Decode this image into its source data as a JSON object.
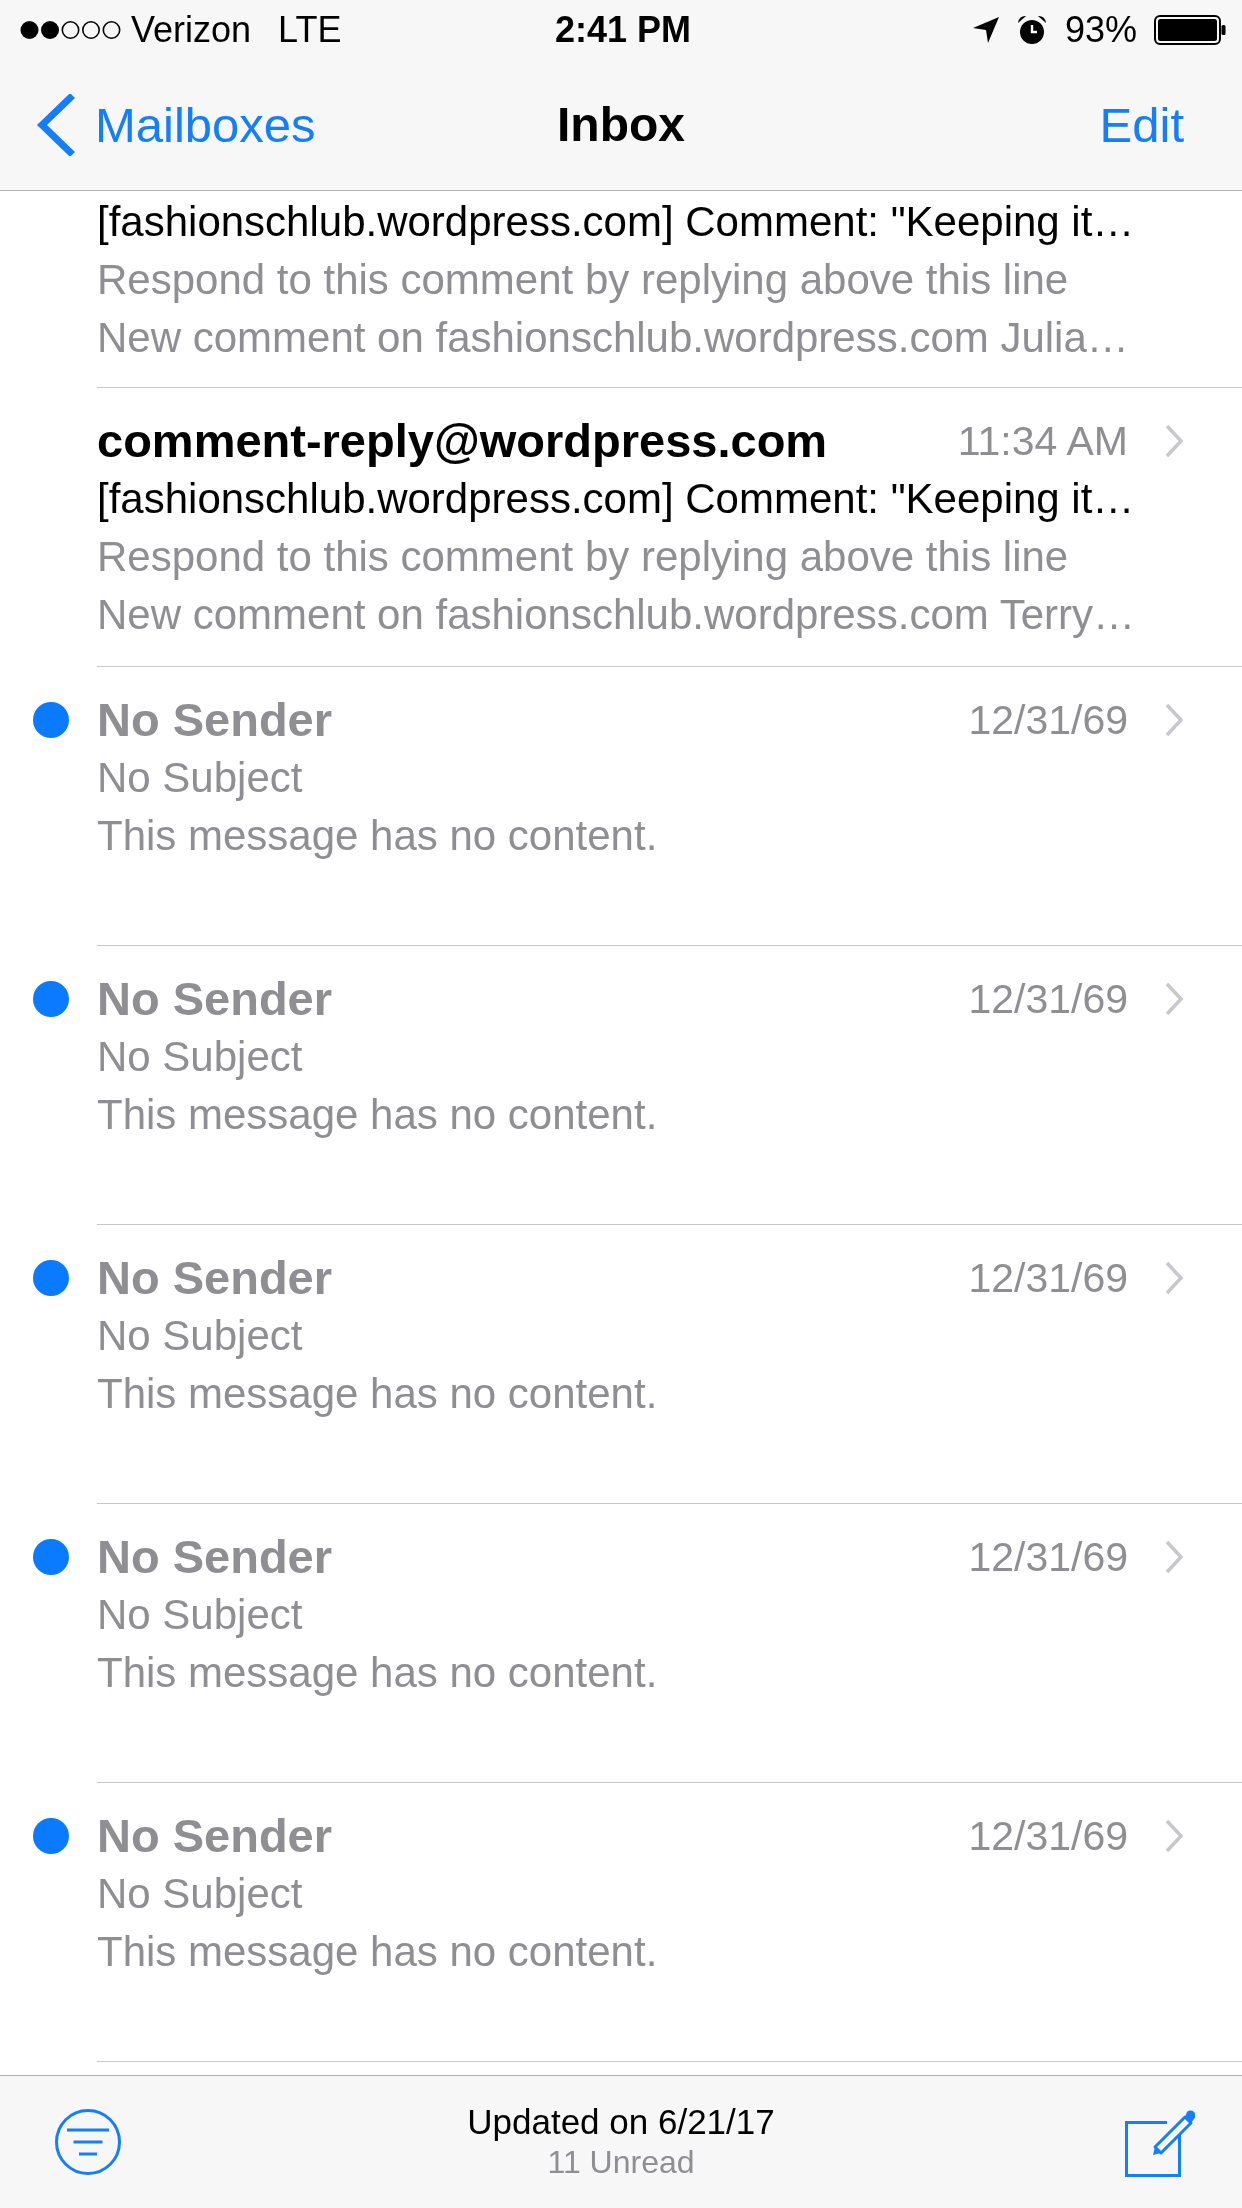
{
  "status_bar": {
    "carrier": "Verizon",
    "network": "LTE",
    "time": "2:41 PM",
    "battery": "93%"
  },
  "nav_bar": {
    "back": "Mailboxes",
    "title": "Inbox",
    "action": "Edit"
  },
  "messages": [
    {
      "kind": "mail",
      "unread": false,
      "subject": "[fashionschlub.wordpress.com] Comment: \"Keeping it…",
      "preview": [
        "Respond to this comment by replying above this line",
        "New comment on fashionschlub.wordpress.com Julia…"
      ]
    },
    {
      "kind": "mail",
      "unread": false,
      "sender": "comment-reply@wordpress.com",
      "time": "11:34 AM",
      "subject": "[fashionschlub.wordpress.com] Comment: \"Keeping it…",
      "preview": [
        "Respond to this comment by replying above this line",
        "New comment on fashionschlub.wordpress.com Terry…"
      ]
    },
    {
      "kind": "empty",
      "unread": true,
      "sender": "No Sender",
      "time": "12/31/69",
      "subject": "No Subject",
      "preview": [
        "This message has no content."
      ]
    },
    {
      "kind": "empty",
      "unread": true,
      "sender": "No Sender",
      "time": "12/31/69",
      "subject": "No Subject",
      "preview": [
        "This message has no content."
      ]
    },
    {
      "kind": "empty",
      "unread": true,
      "sender": "No Sender",
      "time": "12/31/69",
      "subject": "No Subject",
      "preview": [
        "This message has no content."
      ]
    },
    {
      "kind": "empty",
      "unread": true,
      "sender": "No Sender",
      "time": "12/31/69",
      "subject": "No Subject",
      "preview": [
        "This message has no content."
      ]
    },
    {
      "kind": "empty",
      "unread": true,
      "sender": "No Sender",
      "time": "12/31/69",
      "subject": "No Subject",
      "preview": [
        "This message has no content."
      ]
    }
  ],
  "toolbar": {
    "status": "Updated on 6/21/17",
    "unread_count": "11 Unread"
  }
}
